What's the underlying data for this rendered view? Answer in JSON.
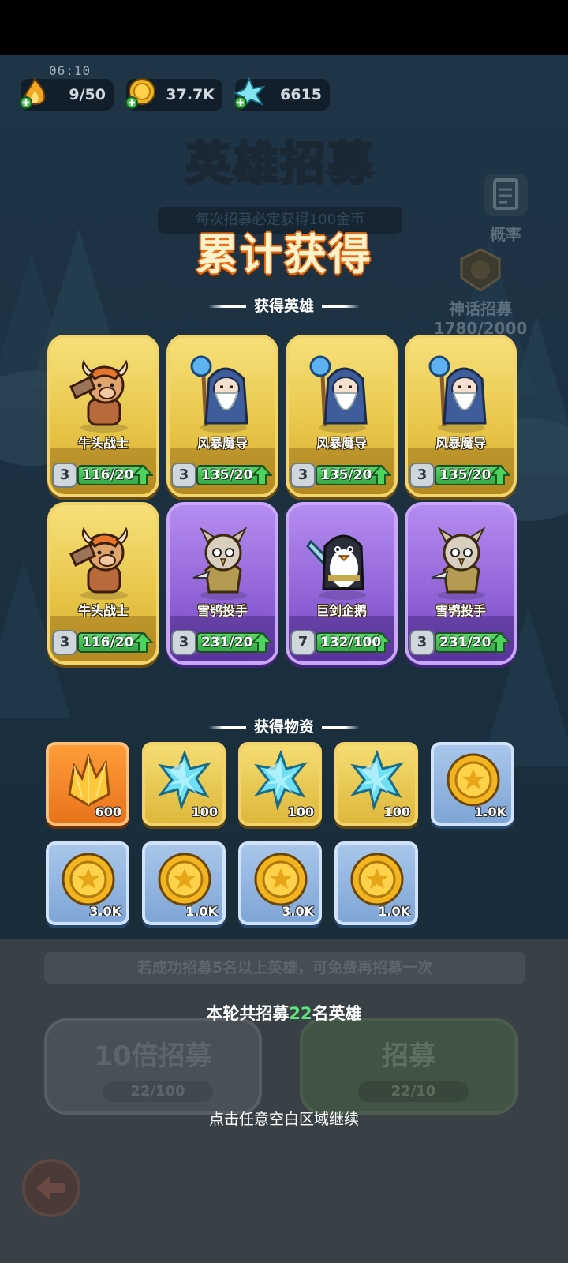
{
  "status": {
    "time": "06:10"
  },
  "resources": [
    {
      "name": "stamina",
      "icon": "fire-stamina-icon",
      "value": "9/50"
    },
    {
      "name": "gold",
      "icon": "gold-coin-plus-icon",
      "value": "37.7K"
    },
    {
      "name": "crystal",
      "icon": "blue-crystal-plus-icon",
      "value": "6615"
    }
  ],
  "background": {
    "title": "英雄招募",
    "subtitle": "每次招募必定获得100金币",
    "prob_label": "概率",
    "mythic_label": "神话招募",
    "mythic_progress": "1780/2000"
  },
  "overlay": {
    "title": "累计获得",
    "heroes_section": "获得英雄",
    "items_section": "获得物资",
    "heroes": [
      {
        "name": "牛头战士",
        "art": "minotaur-warrior-icon",
        "rarity": "gold",
        "level": "3",
        "progress": "116/20",
        "fill": 1.0
      },
      {
        "name": "风暴魔导",
        "art": "storm-mage-icon",
        "rarity": "gold",
        "level": "3",
        "progress": "135/20",
        "fill": 1.0
      },
      {
        "name": "风暴魔导",
        "art": "storm-mage-icon",
        "rarity": "gold",
        "level": "3",
        "progress": "135/20",
        "fill": 1.0
      },
      {
        "name": "风暴魔导",
        "art": "storm-mage-icon",
        "rarity": "gold",
        "level": "3",
        "progress": "135/20",
        "fill": 1.0
      },
      {
        "name": "牛头战士",
        "art": "minotaur-warrior-icon",
        "rarity": "gold",
        "level": "3",
        "progress": "116/20",
        "fill": 1.0
      },
      {
        "name": "雪鸮投手",
        "art": "snow-owl-thrower-icon",
        "rarity": "purple",
        "level": "3",
        "progress": "231/20",
        "fill": 1.0
      },
      {
        "name": "巨剑企鹅",
        "art": "greatsword-penguin-icon",
        "rarity": "purple",
        "level": "7",
        "progress": "132/100",
        "fill": 1.0
      },
      {
        "name": "雪鸮投手",
        "art": "snow-owl-thrower-icon",
        "rarity": "purple",
        "level": "3",
        "progress": "231/20",
        "fill": 1.0
      }
    ],
    "items": [
      {
        "icon": "gold-crystal-icon",
        "frame": "orange",
        "qty": "600"
      },
      {
        "icon": "blue-crystal-icon",
        "frame": "gold",
        "qty": "100"
      },
      {
        "icon": "blue-crystal-icon",
        "frame": "gold",
        "qty": "100"
      },
      {
        "icon": "blue-crystal-icon",
        "frame": "gold",
        "qty": "100"
      },
      {
        "icon": "gold-coin-icon",
        "frame": "blue",
        "qty": "1.0K"
      },
      {
        "icon": "gold-coin-icon",
        "frame": "blue",
        "qty": "3.0K"
      },
      {
        "icon": "gold-coin-icon",
        "frame": "blue",
        "qty": "1.0K"
      },
      {
        "icon": "gold-coin-icon",
        "frame": "blue",
        "qty": "3.0K"
      },
      {
        "icon": "gold-coin-icon",
        "frame": "blue",
        "qty": "1.0K"
      }
    ],
    "total_prefix": "本轮共招募",
    "total_count": "22",
    "total_suffix": "名英雄",
    "continue_text": "点击任意空白区域继续"
  },
  "bottom": {
    "hint": "若成功招募5名以上英雄，可免费再招募一次",
    "ten_pull_label": "10倍招募",
    "ten_pull_count": "22/100",
    "single_pull_label": "招募",
    "single_pull_count": "22/10"
  },
  "colors": {
    "accent_orange": "#e46b14",
    "progress_green": "#33a845",
    "total_green": "#5fe27a"
  }
}
